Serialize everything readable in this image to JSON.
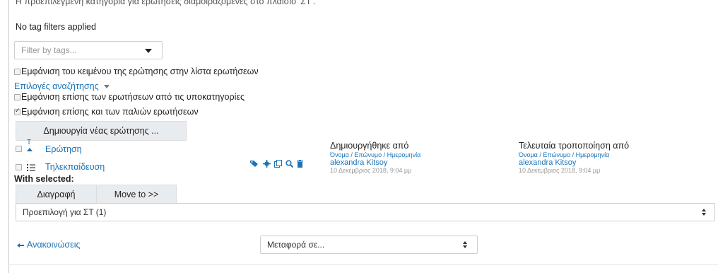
{
  "header": {
    "category_note": "Η προεπιλεγμένη κατηγορία για ερωτήσεις διαμοιραζόμενες στο πλαίσιο 'ΣΤ'.",
    "no_tag_filters": "No tag filters applied",
    "filter_placeholder": "Filter by tags..."
  },
  "options": {
    "show_question_text": "Εμφάνιση του κειμένου της ερώτησης στην λίστα ερωτήσεων",
    "search_options_link": "Επιλογές αναζήτησης",
    "show_subcategories": "Εμφάνιση επίσης των ερωτήσεων από τις υποκατηγορίες",
    "show_old_questions": "Εμφάνιση επίσης και των παλιών ερωτήσεων"
  },
  "create_button": "Δημιουργία νέας ερώτησης ...",
  "table": {
    "sort_letter": "T",
    "col_question": "Ερώτηση",
    "col_created_by": "Δημιουργήθηκε από",
    "col_created_by_sub": "Όνομα / Επώνυμο / Ημερομηνία",
    "col_modified_by": "Τελευταία τροποποίηση από",
    "col_modified_by_sub": "Όνομα / Επώνυμο / Ημερομηνία",
    "rows": [
      {
        "name": "Τηλεκπαίδευση",
        "created_name": "alexandra Kitsoy",
        "created_date": "10 Δεκέμβριος 2018, 9:04 μμ",
        "modified_name": "alexandra Kitsoy",
        "modified_date": "10 Δεκέμβριος 2018, 9:04 μμ"
      }
    ]
  },
  "with_selected": "With selected:",
  "bulk": {
    "delete_label": "Διαγραφή",
    "move_label": "Move to >>",
    "category_select": "Προεπιλογή για ΣΤ (1)"
  },
  "footer": {
    "prev_link": "Ανακοινώσεις",
    "move_select": "Μεταφορά σε..."
  },
  "colors": {
    "link": "#1a73b8",
    "button_bg": "#e9ecef"
  }
}
